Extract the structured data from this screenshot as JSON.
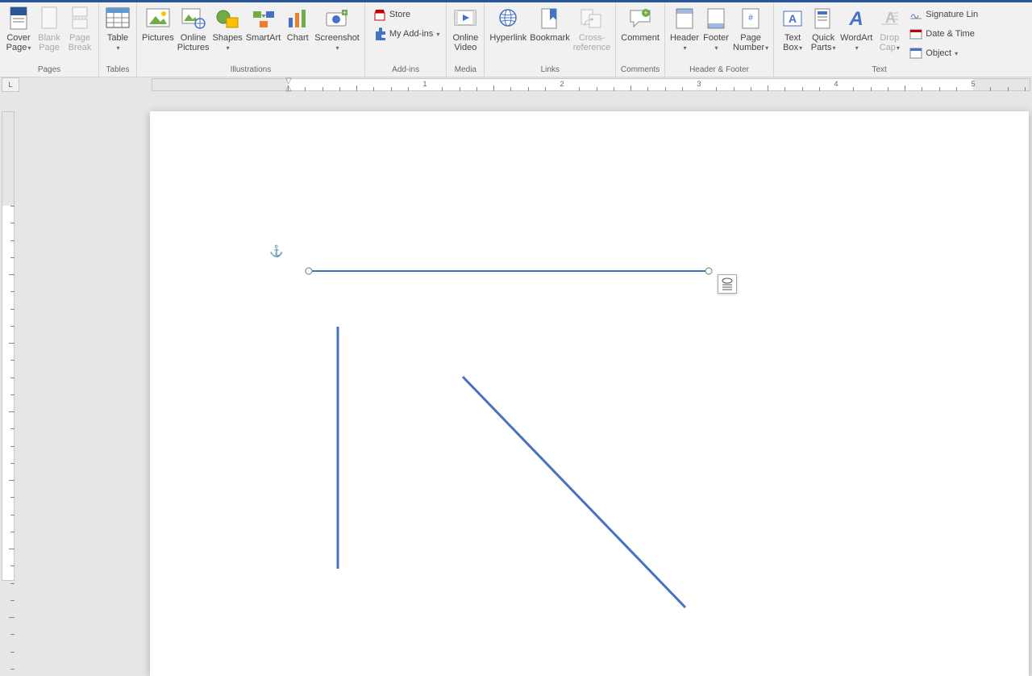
{
  "ribbon": {
    "pages": {
      "label": "Pages",
      "cover": "Cover\nPage",
      "blank": "Blank\nPage",
      "break": "Page\nBreak"
    },
    "tables": {
      "label": "Tables",
      "table": "Table"
    },
    "illustrations": {
      "label": "Illustrations",
      "pictures": "Pictures",
      "online": "Online\nPictures",
      "shapes": "Shapes",
      "smartart": "SmartArt",
      "chart": "Chart",
      "screenshot": "Screenshot"
    },
    "addins": {
      "label": "Add-ins",
      "store": "Store",
      "myaddins": "My Add-ins"
    },
    "media": {
      "label": "Media",
      "video": "Online\nVideo"
    },
    "links": {
      "label": "Links",
      "hyperlink": "Hyperlink",
      "bookmark": "Bookmark",
      "crossref": "Cross-\nreference"
    },
    "comments": {
      "label": "Comments",
      "comment": "Comment"
    },
    "headerfooter": {
      "label": "Header & Footer",
      "header": "Header",
      "footer": "Footer",
      "pagenum": "Page\nNumber"
    },
    "text": {
      "label": "Text",
      "textbox": "Text\nBox",
      "quickparts": "Quick\nParts",
      "wordart": "WordArt",
      "dropcap": "Drop\nCap",
      "sigline": "Signature Lin",
      "datetime": "Date & Time",
      "object": "Object"
    }
  },
  "ruler_numbers": [
    "1",
    "2",
    "3",
    "4",
    "5"
  ],
  "corner": "L"
}
